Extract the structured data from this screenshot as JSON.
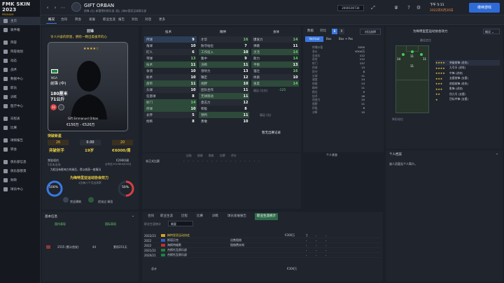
{
  "app": {
    "logo_line1": "FMK SKIN 2023",
    "logo_line2": "PREMIUM"
  },
  "sidebar": {
    "items": [
      {
        "label": "主页"
      },
      {
        "label": "收件箱"
      },
      {
        "label": "阵容"
      },
      {
        "label": "阵容规划"
      },
      {
        "label": "动态"
      },
      {
        "label": "战术"
      },
      {
        "label": "数据中心"
      },
      {
        "label": "职员"
      },
      {
        "label": "训练"
      },
      {
        "label": "医疗中心"
      },
      {
        "label": "日程表"
      },
      {
        "label": "比赛"
      },
      {
        "label": "球探报告"
      },
      {
        "label": "转会"
      },
      {
        "label": "俱乐部信息"
      },
      {
        "label": "俱乐部愿景"
      },
      {
        "label": "财政"
      },
      {
        "label": "球员中心"
      }
    ]
  },
  "topbar": {
    "player_name": "GIFT ORBAN",
    "player_sub": "前锋 (右) 新疆雪豹俱乐部 (租) | 梅州客家足球俱乐部",
    "score_box": "2000100734",
    "date_time": "下午 5:11",
    "date": "2022年6月20日",
    "continue_label": "继续游戏"
  },
  "tabs": [
    "概况",
    "合同",
    "转会",
    "发展",
    "职业生涯",
    "报告",
    "对比",
    "对话",
    "更多"
  ],
  "card": {
    "position_title": "前锋",
    "motto": "令人兴奋的新星，拥有一颗出类拔萃的心",
    "name": "Gift Emmanuel Orban",
    "role": "前锋 (中)",
    "height": "180厘米",
    "weight": "71公斤",
    "age": "20",
    "value": "€150万 - €520万",
    "flag_code": "NGA"
  },
  "summary": {
    "top_label": "突破新星",
    "left_value": "26",
    "mid_value": "0.00",
    "right_value": "20",
    "left_label": "突破射手",
    "mid_label": "19岁",
    "right_label": "€6000/周"
  },
  "contract": {
    "left_label": "常驻续约",
    "left_value": "5次未出场",
    "right_value": "€2900/周",
    "right_label": "合同至2025年6月30日",
    "note": "为相当有影响力的球员，得以前获一般情况"
  },
  "influence": {
    "title": "为梅特里亚运动协会效力",
    "sub": "4位每八个月出场率",
    "left_pct": "100%",
    "right_pct": "50%",
    "left_label": "完全建筑",
    "right_label": "优化过 球员"
  },
  "attributes": {
    "col1_header": "技术",
    "col2_header": "精神",
    "col3_header": "身体",
    "technical": [
      {
        "name": "传球",
        "val": "9"
      },
      {
        "name": "角球",
        "val": "10"
      },
      {
        "name": "盯人",
        "val": "6"
      },
      {
        "name": "带球",
        "val": "13"
      },
      {
        "name": "技术",
        "val": "11"
      },
      {
        "name": "争顶",
        "val": "10"
      },
      {
        "name": "射术",
        "val": "10"
      },
      {
        "name": "盘带",
        "val": "11"
      },
      {
        "name": "头球",
        "val": "10"
      },
      {
        "name": "任意球",
        "val": "8"
      },
      {
        "name": "射门",
        "val": "14"
      },
      {
        "name": "停球",
        "val": "10"
      },
      {
        "name": "长传",
        "val": "5"
      },
      {
        "name": "抢断",
        "val": "8"
      }
    ],
    "mental": [
      {
        "name": "才华",
        "val": "16"
      },
      {
        "name": "防守站位",
        "val": "7"
      },
      {
        "name": "工作投入",
        "val": "10"
      },
      {
        "name": "集中",
        "val": "9"
      },
      {
        "name": "决断",
        "val": "11"
      },
      {
        "name": "领导力",
        "val": "13"
      },
      {
        "name": "镇定",
        "val": "12"
      },
      {
        "name": "视野",
        "val": "10"
      },
      {
        "name": "团队合作",
        "val": "11"
      },
      {
        "name": "无球跑动",
        "val": "11"
      },
      {
        "name": "意志力",
        "val": "12"
      },
      {
        "name": "积极",
        "val": "8"
      },
      {
        "name": "预判",
        "val": "11"
      },
      {
        "name": "勇敢",
        "val": "10"
      }
    ],
    "physical": [
      {
        "name": "爆发力",
        "val": "14"
      },
      {
        "name": "弹跳",
        "val": "11"
      },
      {
        "name": "灵活",
        "val": "14"
      },
      {
        "name": "耐力",
        "val": "14"
      },
      {
        "name": "平衡",
        "val": "13"
      },
      {
        "name": "强壮",
        "val": "16"
      },
      {
        "name": "体质",
        "val": "10"
      },
      {
        "name": "速度",
        "val": "14"
      }
    ],
    "weak_label": "弱足 (左右)",
    "weak_value": "-125",
    "preferred_foot": "弱足 (右)",
    "notes": "暂无出赛记录"
  },
  "stats_panel": {
    "tabs": [
      "数据",
      "对比",
      "B",
      "R"
    ],
    "compare_btn": "对比选择",
    "view_tabs": [
      "Vertical",
      "Box",
      "Box + Pos"
    ],
    "rows": [
      {
        "k": "转播价值",
        "v": "5200"
      },
      {
        "k": "身价",
        "v": "€300万"
      },
      {
        "k": "总成长",
        "v": "112"
      },
      {
        "k": "进攻",
        "v": "112"
      },
      {
        "k": "射门",
        "v": "137"
      },
      {
        "k": "控球",
        "v": "13"
      },
      {
        "k": "防守",
        "v": "8"
      },
      {
        "k": "头球",
        "v": "11"
      },
      {
        "k": "速度",
        "v": "14"
      },
      {
        "k": "体能",
        "v": "13"
      },
      {
        "k": "精神",
        "v": "11"
      },
      {
        "k": "跑位",
        "v": "9"
      },
      {
        "k": "技术",
        "v": "16"
      },
      {
        "k": "创造力",
        "v": "10"
      },
      {
        "k": "视野",
        "v": "11"
      },
      {
        "k": "积极",
        "v": "8"
      },
      {
        "k": "决断",
        "v": "10"
      }
    ]
  },
  "positions": {
    "title": "为梅特里亚运动协会效力",
    "role_label": "角色",
    "best_label": "最佳定位",
    "roles": [
      {
        "name": "突破前锋 (进攻)"
      },
      {
        "name": "九号半 (进攻)"
      },
      {
        "name": "中锋 (进攻)"
      },
      {
        "name": "支援前锋 (支援)"
      },
      {
        "name": "前插前锋 (进攻)"
      },
      {
        "name": "影锋 (进攻)"
      },
      {
        "name": "伪九号 (支援)"
      },
      {
        "name": "目标中锋 (支援)"
      }
    ],
    "pitch_nums": [
      "14",
      "11",
      "11",
      "11"
    ],
    "pitch_label": "阵形站位"
  },
  "personal": {
    "title": "个人档案",
    "text": "该人员暂无个人简介。"
  },
  "match_panel": {
    "header": "非正式比赛",
    "cols": [
      "出场",
      "进球",
      "助攻",
      "红牌",
      "评分"
    ],
    "left_title": "个人状态"
  },
  "club_history": {
    "tabs": [
      "合同",
      "职业生涯",
      "历程",
      "比赛",
      "训练",
      "球员发展报告",
      "职业生涯统计"
    ],
    "dropdown": "概要",
    "rows": [
      {
        "year": "2022/23",
        "club": "梅特里亚运动协会",
        "fee": "€300万",
        "apps": "7",
        "goals": "",
        "ast": "",
        "ratio": "-",
        "rating": "-"
      },
      {
        "year": "2022",
        "club": "斯塔贝克",
        "fee": "",
        "apps": "",
        "goals": "",
        "ast": "",
        "ratio": "",
        "rating": ""
      },
      {
        "year": "2022",
        "club": "海斯特维默",
        "fee": "",
        "apps": "",
        "goals": "",
        "ast": "",
        "ratio": "",
        "rating": ""
      },
      {
        "year": "2021/22",
        "club": "杰斯托瓦俱乐部",
        "fee": "",
        "apps": "",
        "goals": "",
        "ast": "",
        "ratio": "",
        "rating": ""
      },
      {
        "year": "2020/21",
        "club": "杰斯托瓦俱乐部",
        "fee": "",
        "apps": "",
        "goals": "",
        "ast": "",
        "ratio": "",
        "rating": ""
      }
    ],
    "total_label": "总计",
    "total_fee": "€300万",
    "row_fees": [
      "",
      "出售租借",
      "",
      "",
      ""
    ],
    "row_notes": [
      "",
      "出售租借",
      "租借费未知",
      "",
      ""
    ]
  },
  "bottom_left": {
    "title": "基本信息",
    "btn1": "国内表现",
    "btn2": "国际表现",
    "row_a": "2555 (累计首发)",
    "row_b": "44",
    "row_c": "累积251天"
  }
}
